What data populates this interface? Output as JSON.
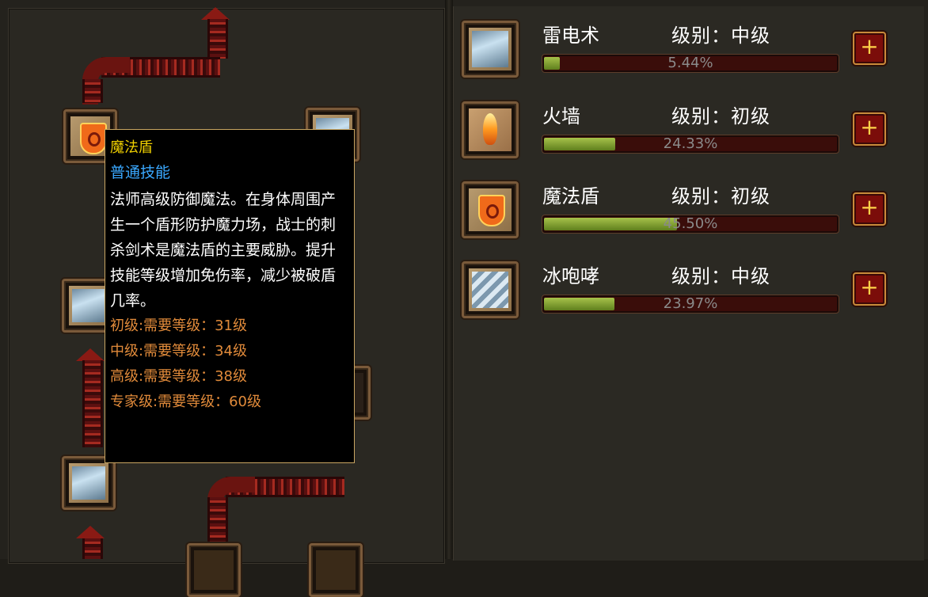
{
  "skills": [
    {
      "name": "雷电术",
      "level_text": "级别：中级",
      "progress": 0.0544,
      "progress_text": "5.44%",
      "icon": "lightning-icon"
    },
    {
      "name": "火墙",
      "level_text": "级别：初级",
      "progress": 0.2433,
      "progress_text": "24.33%",
      "icon": "fire-wall-icon"
    },
    {
      "name": "魔法盾",
      "level_text": "级别：初级",
      "progress": 0.455,
      "progress_text": "45.50%",
      "icon": "magic-shield-icon"
    },
    {
      "name": "冰咆哮",
      "level_text": "级别：中级",
      "progress": 0.2397,
      "progress_text": "23.97%",
      "icon": "ice-roar-icon"
    }
  ],
  "add_button_label": "+",
  "tooltip": {
    "title": "魔法盾",
    "type": "普通技能",
    "description": "法师高级防御魔法。在身体周围产生一个盾形防护魔力场，战士的刺杀剑术是魔法盾的主要威胁。提升技能等级增加免伤率，减少被破盾几率。",
    "requirements": [
      "初级:需要等级：31级",
      "中级:需要等级：34级",
      "高级:需要等级：38级",
      "专家级:需要等级：60级"
    ]
  },
  "colors": {
    "tooltip_title": "#f0d000",
    "tooltip_type": "#3aa8ff",
    "tooltip_requirement": "#e08a3a",
    "progress_fill": "#8aa53a",
    "plus_button": "#7b0d0a"
  }
}
